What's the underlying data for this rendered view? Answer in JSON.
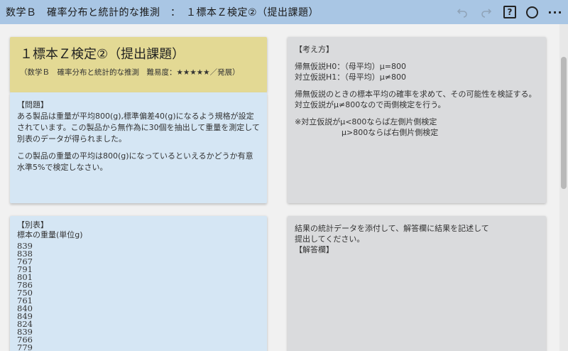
{
  "header": {
    "title": "数学Ｂ　確率分布と統計的な推測　：　１標本Ｚ検定②（提出課題）",
    "undo_icon": "undo-icon",
    "redo_icon": "redo-icon",
    "help_label": "?",
    "more_label": "···"
  },
  "title_card": {
    "heading": "１標本Ｚ検定②（提出課題）",
    "subtitle": "（数学Ｂ　確率分布と統計的な推測　難易度：★★★★★／発展）"
  },
  "problem_card": {
    "heading": "【問題】",
    "para1": "ある製品は重量が平均800(g),標準偏差40(g)になるよう規格が設定されています。この製品から無作為に30個を抽出して重量を測定して別表のデータが得られました。",
    "para2": "この製品の重量の平均は800(g)になっているといえるかどうか有意水準5%で検定しなさい。"
  },
  "think_card": {
    "heading": "【考え方】",
    "h0": "帰無仮説H0：（母平均）μ=800",
    "h1": "対立仮説H1：（母平均）μ≠800",
    "explain1": "帰無仮説のときの標本平均の確率を求めて、その可能性を検証する。",
    "explain2": "対立仮説がμ≠800なので両側検定を行う。",
    "note1": "※対立仮説がμ<800ならば左側片側検定",
    "note2": "μ>800ならば右側片側検定"
  },
  "table_card": {
    "heading": "【別表】",
    "caption": "標本の重量(単位g)",
    "values": [
      "839",
      "838",
      "767",
      "791",
      "801",
      "786",
      "750",
      "761",
      "840",
      "849",
      "824",
      "839",
      "766",
      "779"
    ]
  },
  "answer_card": {
    "line1": "結果の統計データを添付して、解答欄に結果を記述して",
    "line2": "提出してください。",
    "heading": "【解答欄】"
  }
}
